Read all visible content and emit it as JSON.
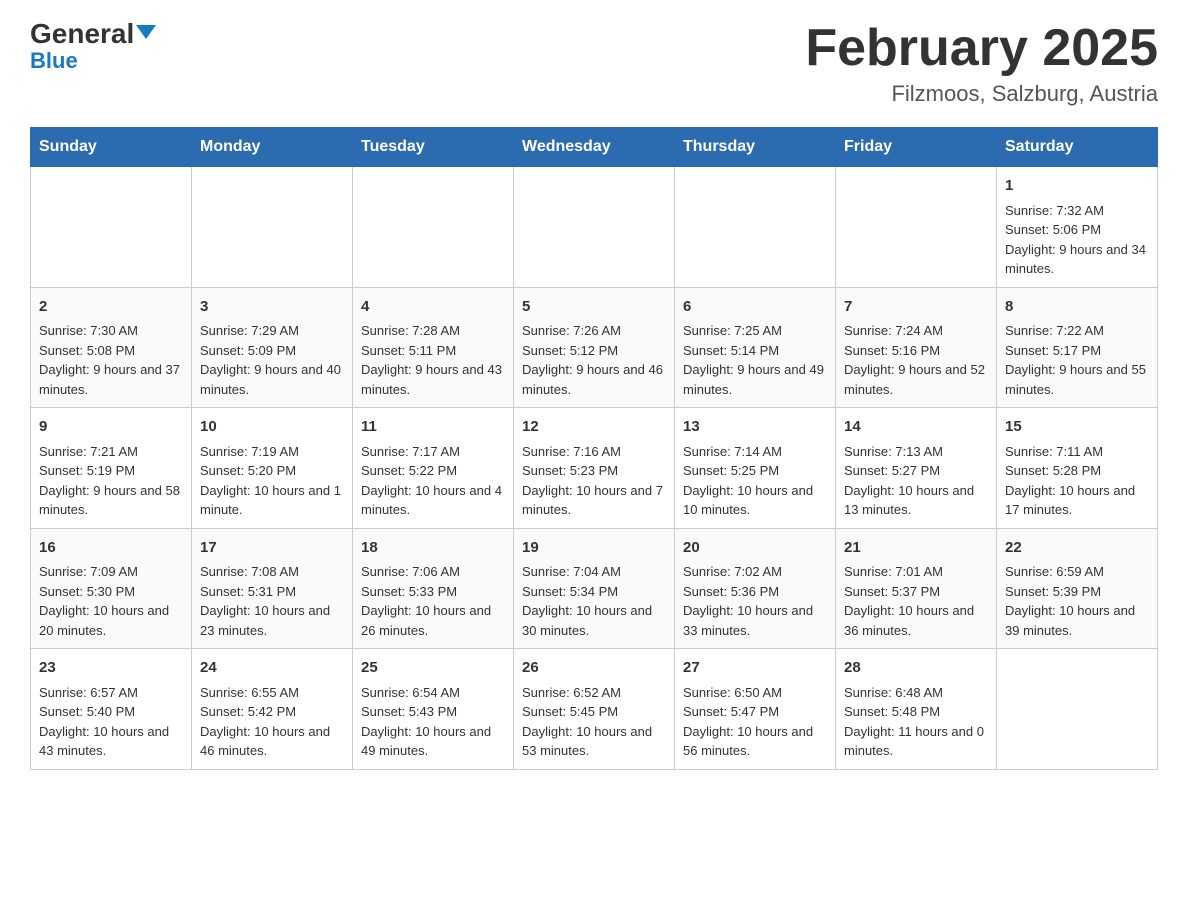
{
  "logo": {
    "general": "General",
    "blue": "Blue",
    "tagline": "Blue"
  },
  "header": {
    "month_year": "February 2025",
    "location": "Filzmoos, Salzburg, Austria"
  },
  "weekdays": [
    "Sunday",
    "Monday",
    "Tuesday",
    "Wednesday",
    "Thursday",
    "Friday",
    "Saturday"
  ],
  "weeks": [
    [
      {
        "day": "",
        "info": ""
      },
      {
        "day": "",
        "info": ""
      },
      {
        "day": "",
        "info": ""
      },
      {
        "day": "",
        "info": ""
      },
      {
        "day": "",
        "info": ""
      },
      {
        "day": "",
        "info": ""
      },
      {
        "day": "1",
        "info": "Sunrise: 7:32 AM\nSunset: 5:06 PM\nDaylight: 9 hours and 34 minutes."
      }
    ],
    [
      {
        "day": "2",
        "info": "Sunrise: 7:30 AM\nSunset: 5:08 PM\nDaylight: 9 hours and 37 minutes."
      },
      {
        "day": "3",
        "info": "Sunrise: 7:29 AM\nSunset: 5:09 PM\nDaylight: 9 hours and 40 minutes."
      },
      {
        "day": "4",
        "info": "Sunrise: 7:28 AM\nSunset: 5:11 PM\nDaylight: 9 hours and 43 minutes."
      },
      {
        "day": "5",
        "info": "Sunrise: 7:26 AM\nSunset: 5:12 PM\nDaylight: 9 hours and 46 minutes."
      },
      {
        "day": "6",
        "info": "Sunrise: 7:25 AM\nSunset: 5:14 PM\nDaylight: 9 hours and 49 minutes."
      },
      {
        "day": "7",
        "info": "Sunrise: 7:24 AM\nSunset: 5:16 PM\nDaylight: 9 hours and 52 minutes."
      },
      {
        "day": "8",
        "info": "Sunrise: 7:22 AM\nSunset: 5:17 PM\nDaylight: 9 hours and 55 minutes."
      }
    ],
    [
      {
        "day": "9",
        "info": "Sunrise: 7:21 AM\nSunset: 5:19 PM\nDaylight: 9 hours and 58 minutes."
      },
      {
        "day": "10",
        "info": "Sunrise: 7:19 AM\nSunset: 5:20 PM\nDaylight: 10 hours and 1 minute."
      },
      {
        "day": "11",
        "info": "Sunrise: 7:17 AM\nSunset: 5:22 PM\nDaylight: 10 hours and 4 minutes."
      },
      {
        "day": "12",
        "info": "Sunrise: 7:16 AM\nSunset: 5:23 PM\nDaylight: 10 hours and 7 minutes."
      },
      {
        "day": "13",
        "info": "Sunrise: 7:14 AM\nSunset: 5:25 PM\nDaylight: 10 hours and 10 minutes."
      },
      {
        "day": "14",
        "info": "Sunrise: 7:13 AM\nSunset: 5:27 PM\nDaylight: 10 hours and 13 minutes."
      },
      {
        "day": "15",
        "info": "Sunrise: 7:11 AM\nSunset: 5:28 PM\nDaylight: 10 hours and 17 minutes."
      }
    ],
    [
      {
        "day": "16",
        "info": "Sunrise: 7:09 AM\nSunset: 5:30 PM\nDaylight: 10 hours and 20 minutes."
      },
      {
        "day": "17",
        "info": "Sunrise: 7:08 AM\nSunset: 5:31 PM\nDaylight: 10 hours and 23 minutes."
      },
      {
        "day": "18",
        "info": "Sunrise: 7:06 AM\nSunset: 5:33 PM\nDaylight: 10 hours and 26 minutes."
      },
      {
        "day": "19",
        "info": "Sunrise: 7:04 AM\nSunset: 5:34 PM\nDaylight: 10 hours and 30 minutes."
      },
      {
        "day": "20",
        "info": "Sunrise: 7:02 AM\nSunset: 5:36 PM\nDaylight: 10 hours and 33 minutes."
      },
      {
        "day": "21",
        "info": "Sunrise: 7:01 AM\nSunset: 5:37 PM\nDaylight: 10 hours and 36 minutes."
      },
      {
        "day": "22",
        "info": "Sunrise: 6:59 AM\nSunset: 5:39 PM\nDaylight: 10 hours and 39 minutes."
      }
    ],
    [
      {
        "day": "23",
        "info": "Sunrise: 6:57 AM\nSunset: 5:40 PM\nDaylight: 10 hours and 43 minutes."
      },
      {
        "day": "24",
        "info": "Sunrise: 6:55 AM\nSunset: 5:42 PM\nDaylight: 10 hours and 46 minutes."
      },
      {
        "day": "25",
        "info": "Sunrise: 6:54 AM\nSunset: 5:43 PM\nDaylight: 10 hours and 49 minutes."
      },
      {
        "day": "26",
        "info": "Sunrise: 6:52 AM\nSunset: 5:45 PM\nDaylight: 10 hours and 53 minutes."
      },
      {
        "day": "27",
        "info": "Sunrise: 6:50 AM\nSunset: 5:47 PM\nDaylight: 10 hours and 56 minutes."
      },
      {
        "day": "28",
        "info": "Sunrise: 6:48 AM\nSunset: 5:48 PM\nDaylight: 11 hours and 0 minutes."
      },
      {
        "day": "",
        "info": ""
      }
    ]
  ]
}
